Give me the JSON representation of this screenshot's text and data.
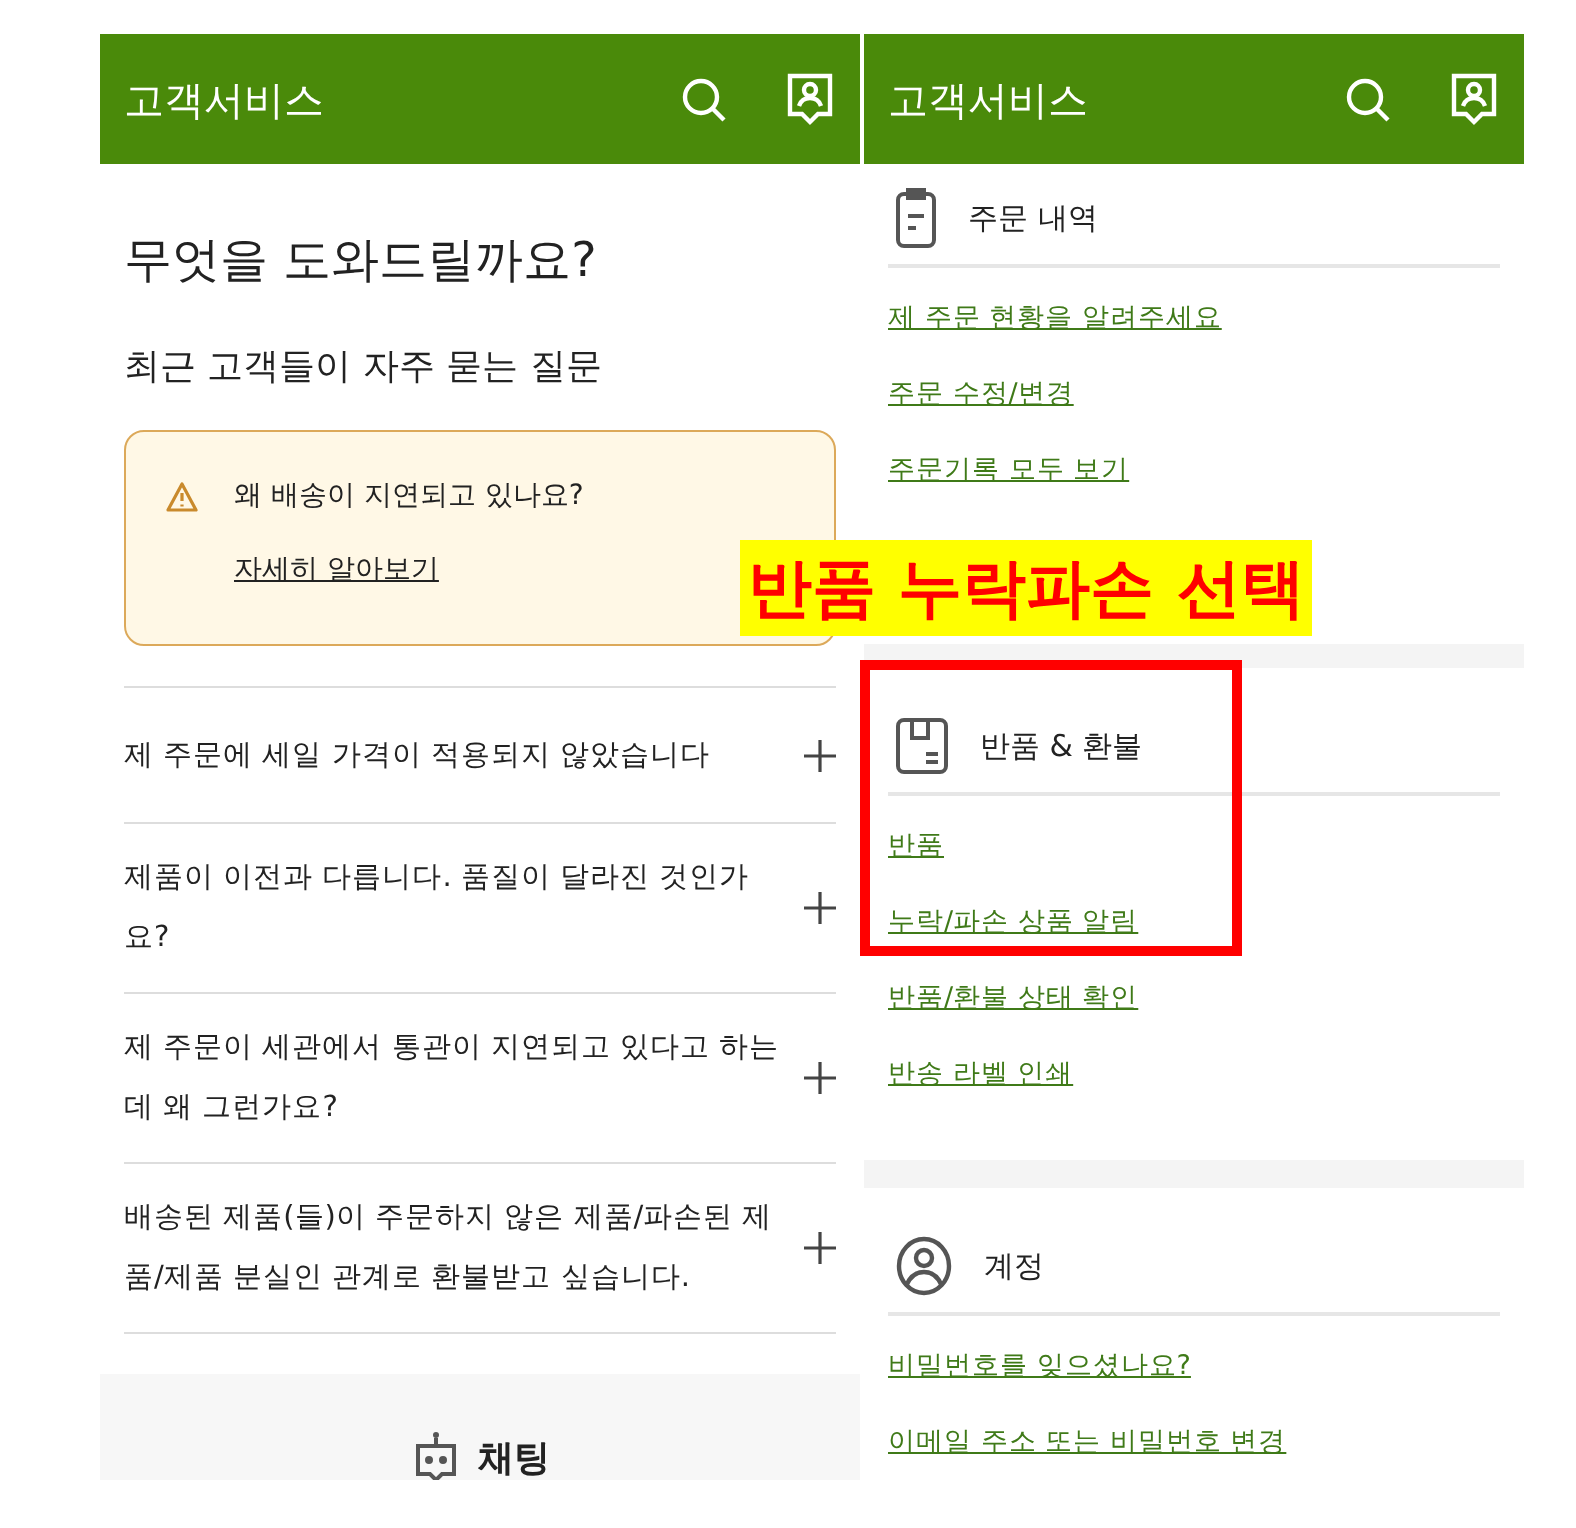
{
  "left": {
    "header": {
      "title": "고객서비스"
    },
    "heading": "무엇을 도와드릴까요?",
    "subheading": "최근 고객들이 자주 묻는 질문",
    "notice": {
      "text": "왜 배송이 지연되고 있나요?",
      "link": "자세히 알아보기"
    },
    "faqs": [
      {
        "question": "제 주문에 세일 가격이 적용되지 않았습니다",
        "expanded": false
      },
      {
        "question": "제품이 이전과 다릅니다. 품질이 달라진 것인가요?",
        "expanded": false
      },
      {
        "question": "제 주문이 세관에서 통관이 지연되고 있다고 하는데 왜 그런가요?",
        "expanded": false
      },
      {
        "question": "배송된 제품(들)이 주문하지 않은 제품/파손된 제품/제품 분실인 관계로 환불받고 싶습니다.",
        "expanded": false
      }
    ],
    "chat": {
      "label": "채팅"
    }
  },
  "right": {
    "header": {
      "title": "고객서비스"
    },
    "sections": [
      {
        "kind": "orders",
        "title": "주문 내역",
        "links": [
          "제 주문 현황을 알려주세요",
          "주문 수정/변경",
          "주문기록 모두 보기"
        ]
      },
      {
        "kind": "returns",
        "title": "반품 & 환불",
        "links": [
          "반품",
          "누락/파손 상품 알림",
          "반품/환불 상태 확인",
          "반송 라벨 인쇄"
        ]
      },
      {
        "kind": "account",
        "title": "계정",
        "links": [
          "비밀번호를 잊으셨나요?",
          "이메일 주소 또는 비밀번호 변경"
        ]
      }
    ]
  },
  "annotation": {
    "caption": "반품 누락파손 선택"
  }
}
